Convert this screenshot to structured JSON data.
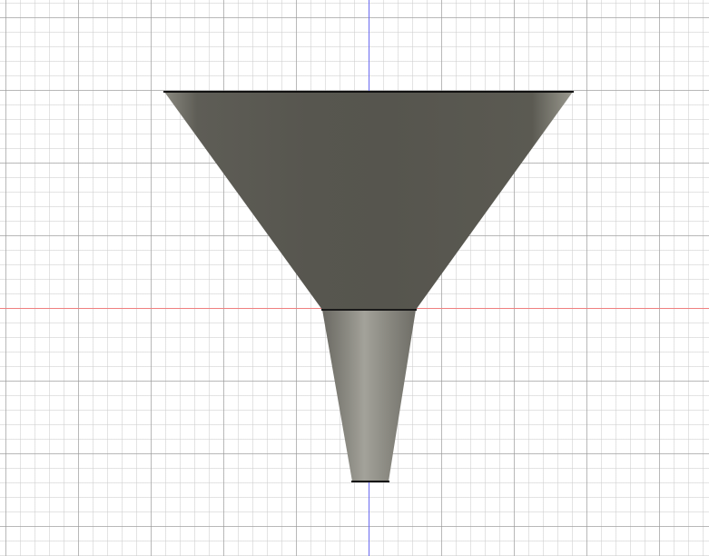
{
  "viewport": {
    "view": "front",
    "model": "funnel"
  },
  "colors": {
    "x_axis": "#f08080",
    "y_axis": "#6a6af0",
    "cone": "#57554e",
    "spout": "#8e8d85"
  }
}
